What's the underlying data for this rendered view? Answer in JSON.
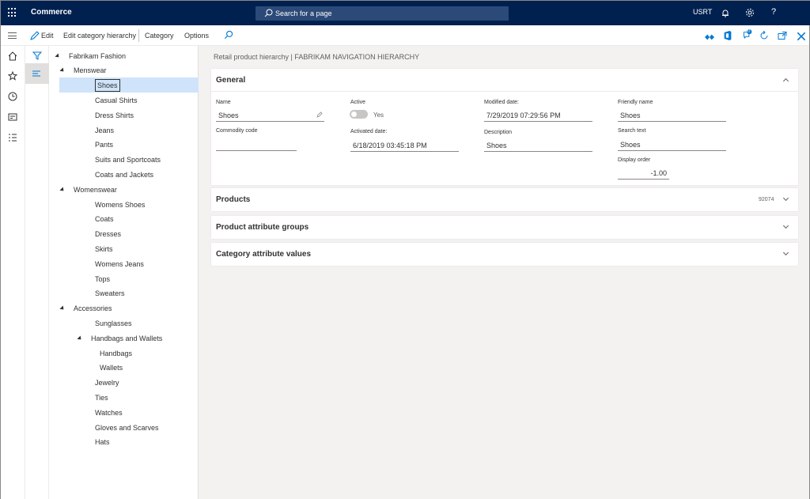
{
  "app": {
    "title": "Commerce",
    "search_placeholder": "Search for a page",
    "company": "USRT",
    "help": "?",
    "notification_badge": "0"
  },
  "actionbar": {
    "edit": "Edit",
    "edit_hierarchy": "Edit category hierarchy",
    "category": "Category",
    "options": "Options"
  },
  "tree": {
    "items": [
      {
        "label": "Fabrikam Fashion",
        "level": 0,
        "expanded": true
      },
      {
        "label": "Menswear",
        "level": 1,
        "expanded": true
      },
      {
        "label": "Shoes",
        "level": 2,
        "selected": true
      },
      {
        "label": "Casual Shirts",
        "level": 2
      },
      {
        "label": "Dress Shirts",
        "level": 2
      },
      {
        "label": "Jeans",
        "level": 2
      },
      {
        "label": "Pants",
        "level": 2
      },
      {
        "label": "Suits and Sportcoats",
        "level": 2
      },
      {
        "label": "Coats and Jackets",
        "level": 2
      },
      {
        "label": "Womenswear",
        "level": 1,
        "expanded": true
      },
      {
        "label": "Womens Shoes",
        "level": 2
      },
      {
        "label": "Coats",
        "level": 2
      },
      {
        "label": "Dresses",
        "level": 2
      },
      {
        "label": "Skirts",
        "level": 2
      },
      {
        "label": "Womens Jeans",
        "level": 2
      },
      {
        "label": "Tops",
        "level": 2
      },
      {
        "label": "Sweaters",
        "level": 2
      },
      {
        "label": "Accessories",
        "level": 1,
        "expanded": true
      },
      {
        "label": "Sunglasses",
        "level": 2
      },
      {
        "label": "Handbags and Wallets",
        "level": 2,
        "expanded": true
      },
      {
        "label": "Handbags",
        "level": 3
      },
      {
        "label": "Wallets",
        "level": 3
      },
      {
        "label": "Jewelry",
        "level": 2
      },
      {
        "label": "Ties",
        "level": 2
      },
      {
        "label": "Watches",
        "level": 2
      },
      {
        "label": "Gloves and Scarves",
        "level": 2
      },
      {
        "label": "Hats",
        "level": 2
      }
    ]
  },
  "main": {
    "breadcrumb": "Retail product hierarchy  |  FABRIKAM NAVIGATION HIERARCHY",
    "general": {
      "title": "General",
      "name_label": "Name",
      "name_value": "Shoes",
      "commodity_label": "Commodity code",
      "commodity_value": "",
      "active_label": "Active",
      "active_value": "Yes",
      "activated_label": "Activated date:",
      "activated_value": "6/18/2019 03:45:18 PM",
      "modified_label": "Modified date:",
      "modified_value": "7/29/2019 07:29:56 PM",
      "description_label": "Description",
      "description_value": "Shoes",
      "friendly_label": "Friendly name",
      "friendly_value": "Shoes",
      "search_label": "Search text",
      "search_value": "Shoes",
      "display_order_label": "Display order",
      "display_order_value": "-1.00"
    },
    "products": {
      "title": "Products",
      "count": "92074"
    },
    "attr_groups": {
      "title": "Product attribute groups"
    },
    "category_attr": {
      "title": "Category attribute values"
    }
  }
}
